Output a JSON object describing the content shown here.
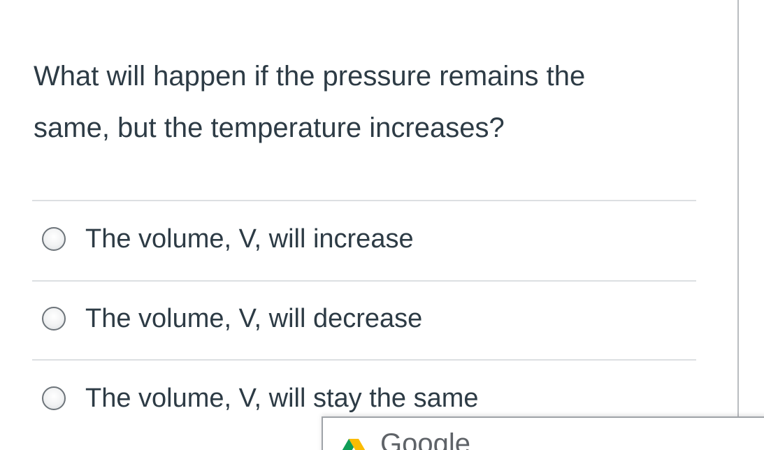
{
  "question": {
    "line1": "What will happen if the pressure remains the",
    "line2": "same, but the temperature increases?"
  },
  "options": [
    {
      "label": "The volume, V, will increase",
      "selected": false
    },
    {
      "label": "The volume, V, will decrease",
      "selected": false
    },
    {
      "label": "The volume, V, will stay the same",
      "selected": false
    }
  ],
  "popup": {
    "title": "Google",
    "icon": "google-drive-icon"
  },
  "colors": {
    "text": "#2d3b45",
    "divider": "#dcdfe2",
    "border": "#b9bcc0"
  }
}
